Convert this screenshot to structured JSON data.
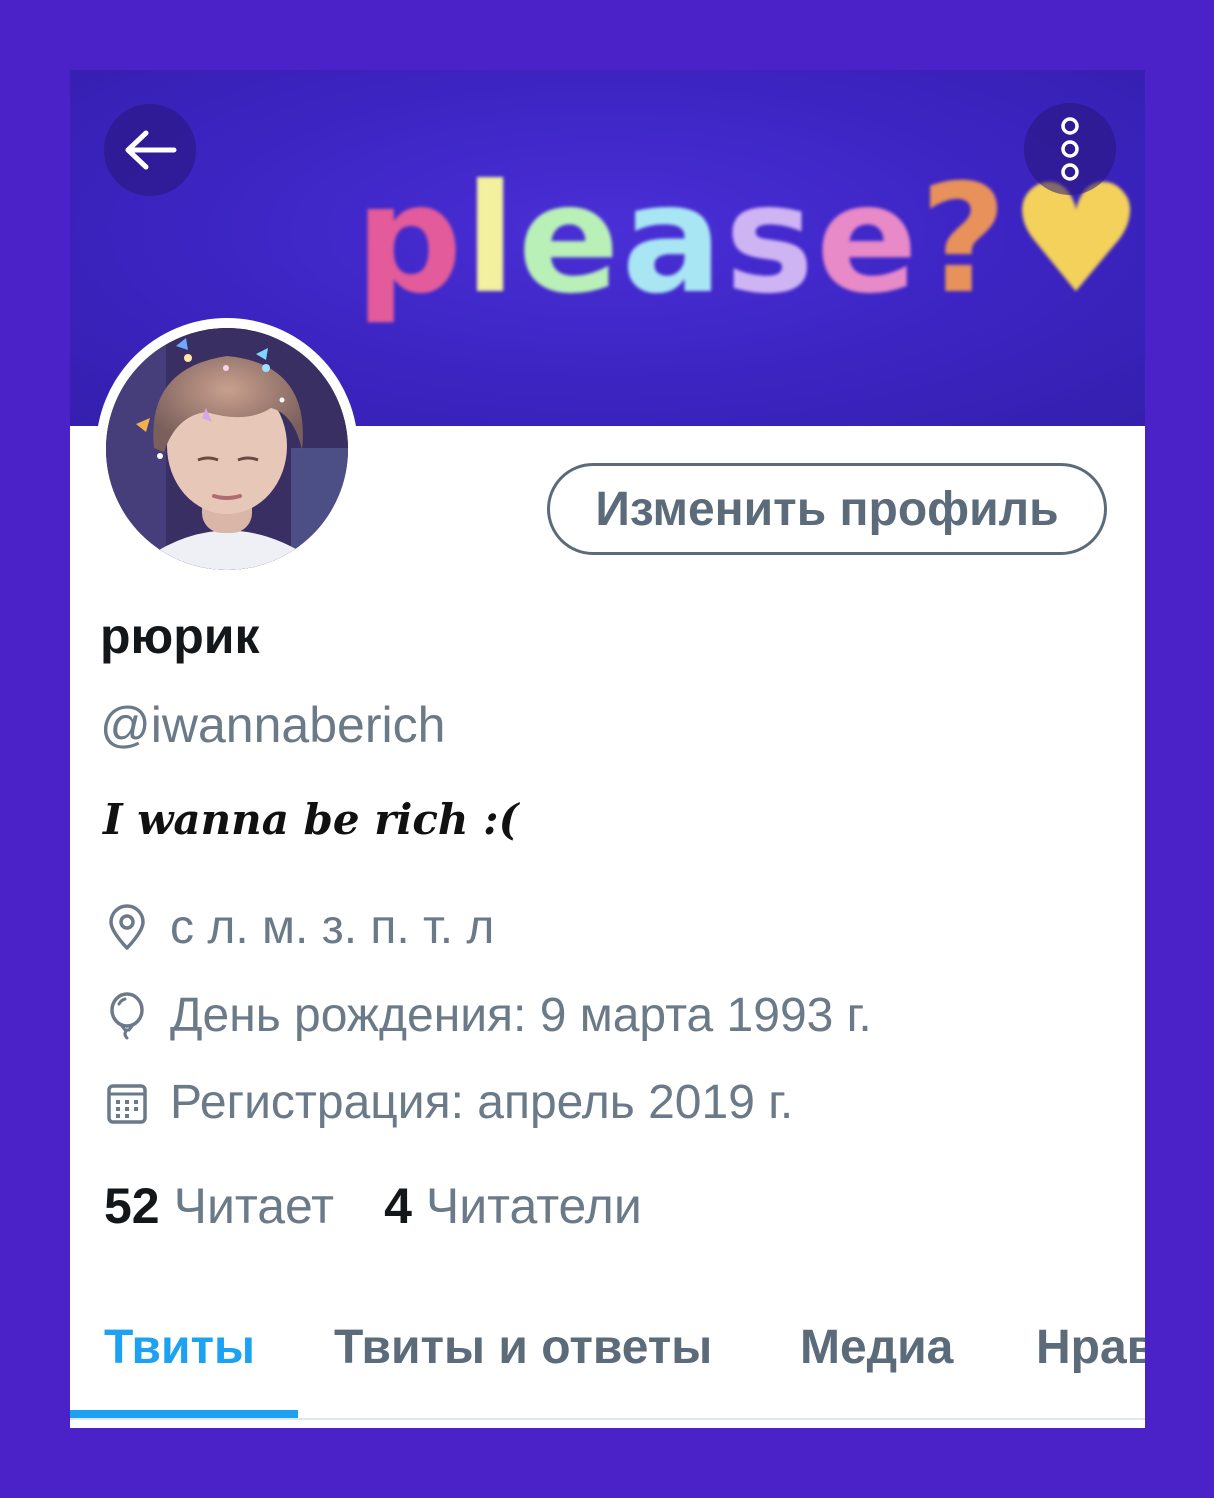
{
  "banner": {
    "text_parts": [
      "p",
      "l",
      "e",
      "a",
      "s",
      "e",
      "?",
      "♥"
    ]
  },
  "header": {
    "back_icon": "arrow-left-icon",
    "more_icon": "more-vertical-icon"
  },
  "profile": {
    "edit_button_label": "Изменить профиль",
    "display_name": "рюрик",
    "handle": "@iwannaberich",
    "bio": "I wanna be rich :(",
    "location": "с л. м. з. п. т. л",
    "birthday": "День рождения: 9 марта 1993 г.",
    "joined": "Регистрация: апрель 2019 г."
  },
  "stats": {
    "following_count": "52",
    "following_label": "Читает",
    "followers_count": "4",
    "followers_label": "Читатели"
  },
  "tabs": [
    {
      "label": "Твиты",
      "active": true
    },
    {
      "label": "Твиты и ответы",
      "active": false
    },
    {
      "label": "Медиа",
      "active": false
    },
    {
      "label": "Нрав",
      "active": false
    }
  ],
  "colors": {
    "accent": "#1da1f2",
    "page_background": "#4a22c8",
    "secondary_text": "#6b7a88"
  }
}
